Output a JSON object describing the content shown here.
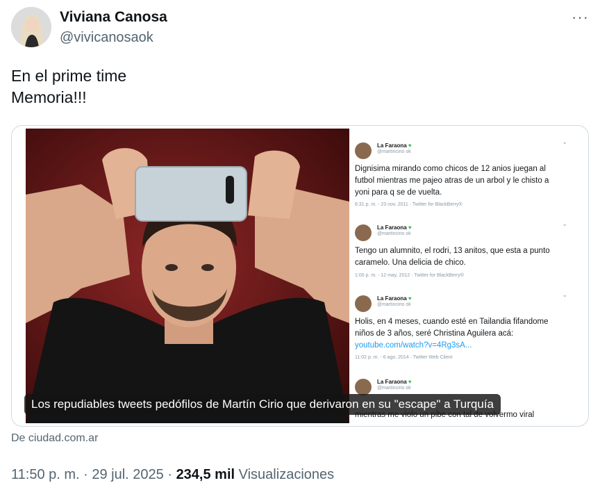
{
  "author": {
    "display_name": "Viviana Canosa",
    "handle": "@vivicanosaok"
  },
  "tweet": {
    "lines": [
      "En el prime time",
      "Memoria!!!"
    ]
  },
  "card": {
    "caption": "Los repudiables tweets pedófilos de Martín Cirio que derivaron en su \"escape\" a Turquía",
    "source": "De ciudad.com.ar",
    "embedded_tweets": [
      {
        "name": "La Faraona",
        "handle": "@martincirio ok",
        "text": "Dignisima mirando como chicos de 12 anios juegan al futbol mientras me pajeo atras de un arbol y le chisto a yoni para q se de vuelta.",
        "meta": "6:31 p. m. - 23 nov. 2011 · Twitter for BlackBerry®"
      },
      {
        "name": "La Faraona",
        "handle": "@martincirio ok",
        "text": "Tengo un alumnito, el rodri, 13 anitos, que esta a punto caramelo. Una delicia de chico.",
        "meta": "1:00 p. m. - 12 may. 2012 · Twitter for BlackBerry®"
      },
      {
        "name": "La Faraona",
        "handle": "@martincirio ok",
        "text": "Holis, en 4 meses, cuando esté en Tailandia fifandome niños de 3 años, seré Christina Aguilera acá: ",
        "link": "youtube.com/watch?v=4Rg3sA...",
        "meta": "11:02 p. m. - 6 ago. 2014 · Twitter Web Client"
      },
      {
        "name": "La Faraona",
        "handle": "@martincirio ok",
        "text": "mientras me violo un pibe con tal de volvermo viral",
        "meta": ""
      }
    ]
  },
  "meta": {
    "time": "11:50 p. m.",
    "sep1": " · ",
    "date": "29 jul. 2025",
    "sep2": " · ",
    "views_count": "234,5 mil",
    "views_label": " Visualizaciones"
  },
  "icons": {
    "more": "more-horizontal-icon",
    "heart": "green-heart-icon"
  },
  "colors": {
    "text_primary": "#0f1419",
    "text_secondary": "#536471",
    "border": "#cfd9de",
    "link": "#1d9bf0"
  }
}
